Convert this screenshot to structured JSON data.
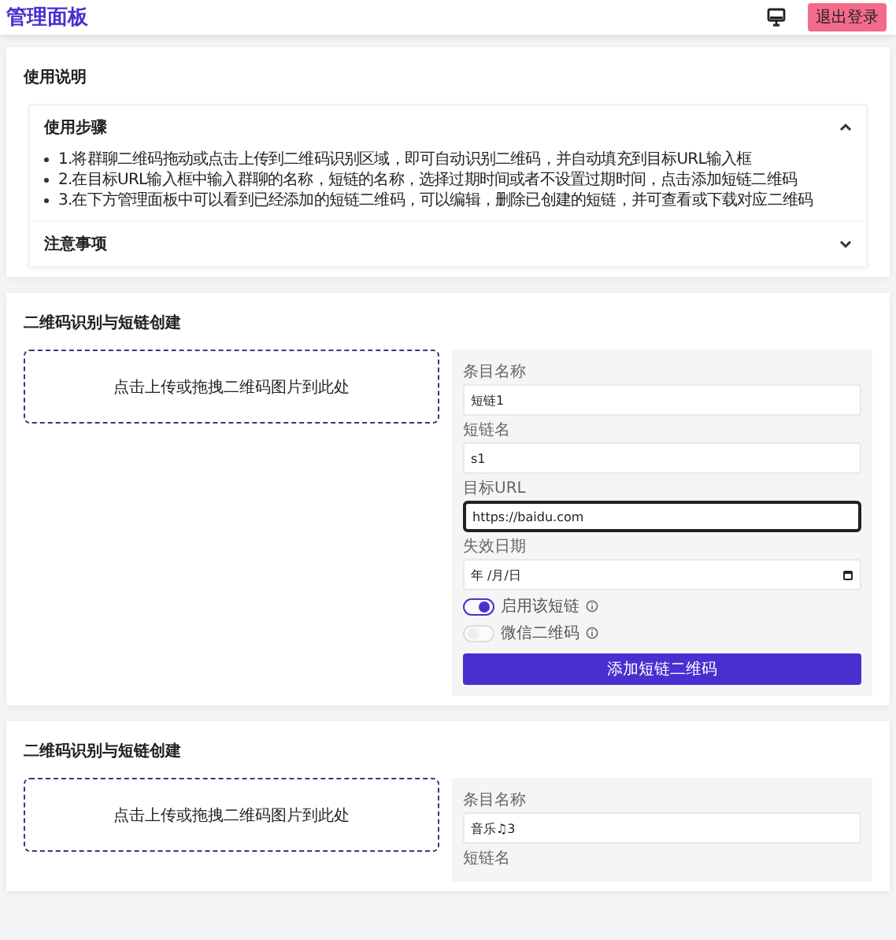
{
  "header": {
    "title": "管理面板",
    "logout": "退出登录"
  },
  "guide": {
    "title": "使用说明",
    "sections": [
      {
        "title": "使用步骤",
        "expanded": true,
        "items": [
          "1.将群聊二维码拖动或点击上传到二维码识别区域，即可自动识别二维码，并自动填充到目标URL输入框",
          "2.在目标URL输入框中输入群聊的名称，短链的名称，选择过期时间或者不设置过期时间，点击添加短链二维码",
          "3.在下方管理面板中可以看到已经添加的短链二维码，可以编辑，删除已创建的短链，并可查看或下载对应二维码"
        ]
      },
      {
        "title": "注意事项",
        "expanded": false
      }
    ]
  },
  "creators": [
    {
      "title": "二维码识别与短链创建",
      "dropzone": "点击上传或拖拽二维码图片到此处",
      "fields": [
        {
          "kind": "text",
          "label": "条目名称",
          "value": "短链1"
        },
        {
          "kind": "text",
          "label": "短链名",
          "value": "s1"
        },
        {
          "kind": "text",
          "label": "目标URL",
          "value": "https://baidu.com",
          "focused": true
        },
        {
          "kind": "date",
          "label": "失效日期",
          "value": "年 /月/日"
        }
      ],
      "toggles": [
        {
          "label": "启用该短链",
          "on": true
        },
        {
          "label": "微信二维码",
          "on": false
        }
      ],
      "submit": "添加短链二维码"
    },
    {
      "title": "二维码识别与短链创建",
      "dropzone": "点击上传或拖拽二维码图片到此处",
      "fields": [
        {
          "kind": "text",
          "label": "条目名称",
          "value": "音乐♫3"
        },
        {
          "label": "短链名"
        }
      ]
    }
  ]
}
